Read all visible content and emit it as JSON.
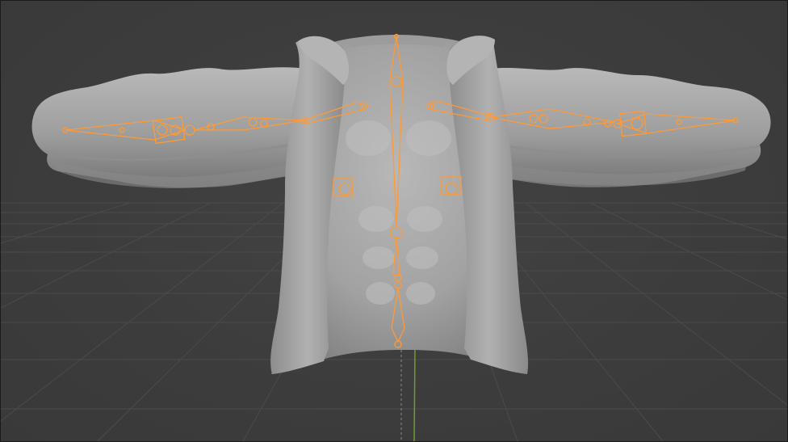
{
  "viewport": {
    "background_color": "#3d3d3d",
    "grid_color": "#4a4a4a",
    "axis_y_color": "#6aa028",
    "axis_z_color": "#7a7a7a",
    "mesh_color": "#a6a6a6",
    "armature_color": "#ff9a35"
  },
  "scene": {
    "object": "sculpted-jacket-mesh",
    "armature": "rig-bones",
    "icons": [
      "bone-octahedral-icon",
      "bone-joint-circle-icon",
      "custom-bone-shape-icon"
    ]
  }
}
